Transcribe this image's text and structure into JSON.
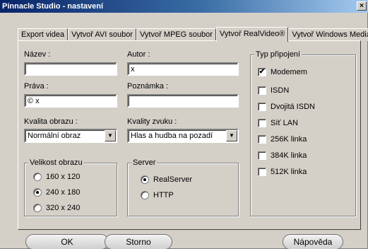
{
  "window": {
    "title": "Pinnacle Studio - nastavení",
    "close_label": "×"
  },
  "tabs": [
    {
      "label": "Export videa"
    },
    {
      "label": "Vytvoř AVI soubor"
    },
    {
      "label": "Vytvoř MPEG soubor"
    },
    {
      "label": "Vytvoř RealVideo®"
    },
    {
      "label": "Vytvoř Windows Media®"
    }
  ],
  "form": {
    "nazev_label": "Název :",
    "nazev_value": "",
    "autor_label": "Autor :",
    "autor_value": "x",
    "prava_label": "Práva :",
    "prava_value": "© x",
    "poznamka_label": "Poznámka :",
    "poznamka_value": "",
    "kvalita_obrazu_label": "Kvalita obrazu :",
    "kvalita_obrazu_value": "Normální obraz",
    "kvality_zvuku_label": "Kvality zvuku :",
    "kvality_zvuku_value": "Hlas a hudba na pozadí",
    "arrow_glyph": "▼"
  },
  "velikost": {
    "title": "Velikost obrazu",
    "options": [
      {
        "label": "160 x 120",
        "selected": false
      },
      {
        "label": "240 x 180",
        "selected": true
      },
      {
        "label": "320 x 240",
        "selected": false
      }
    ]
  },
  "server": {
    "title": "Server",
    "options": [
      {
        "label": "RealServer",
        "selected": true
      },
      {
        "label": "HTTP",
        "selected": false
      }
    ]
  },
  "pripojeni": {
    "title": "Typ připojení",
    "check_glyph": "✔",
    "options": [
      {
        "label": "Modemem",
        "checked": true
      },
      {
        "label": "ISDN",
        "checked": false
      },
      {
        "label": "Dvojitá ISDN",
        "checked": false
      },
      {
        "label": "Síť LAN",
        "checked": false
      },
      {
        "label": "256K linka",
        "checked": false
      },
      {
        "label": "384K linka",
        "checked": false
      },
      {
        "label": "512K linka",
        "checked": false
      }
    ]
  },
  "buttons": {
    "ok": "OK",
    "storno": "Storno",
    "napoveda": "Nápověda"
  }
}
